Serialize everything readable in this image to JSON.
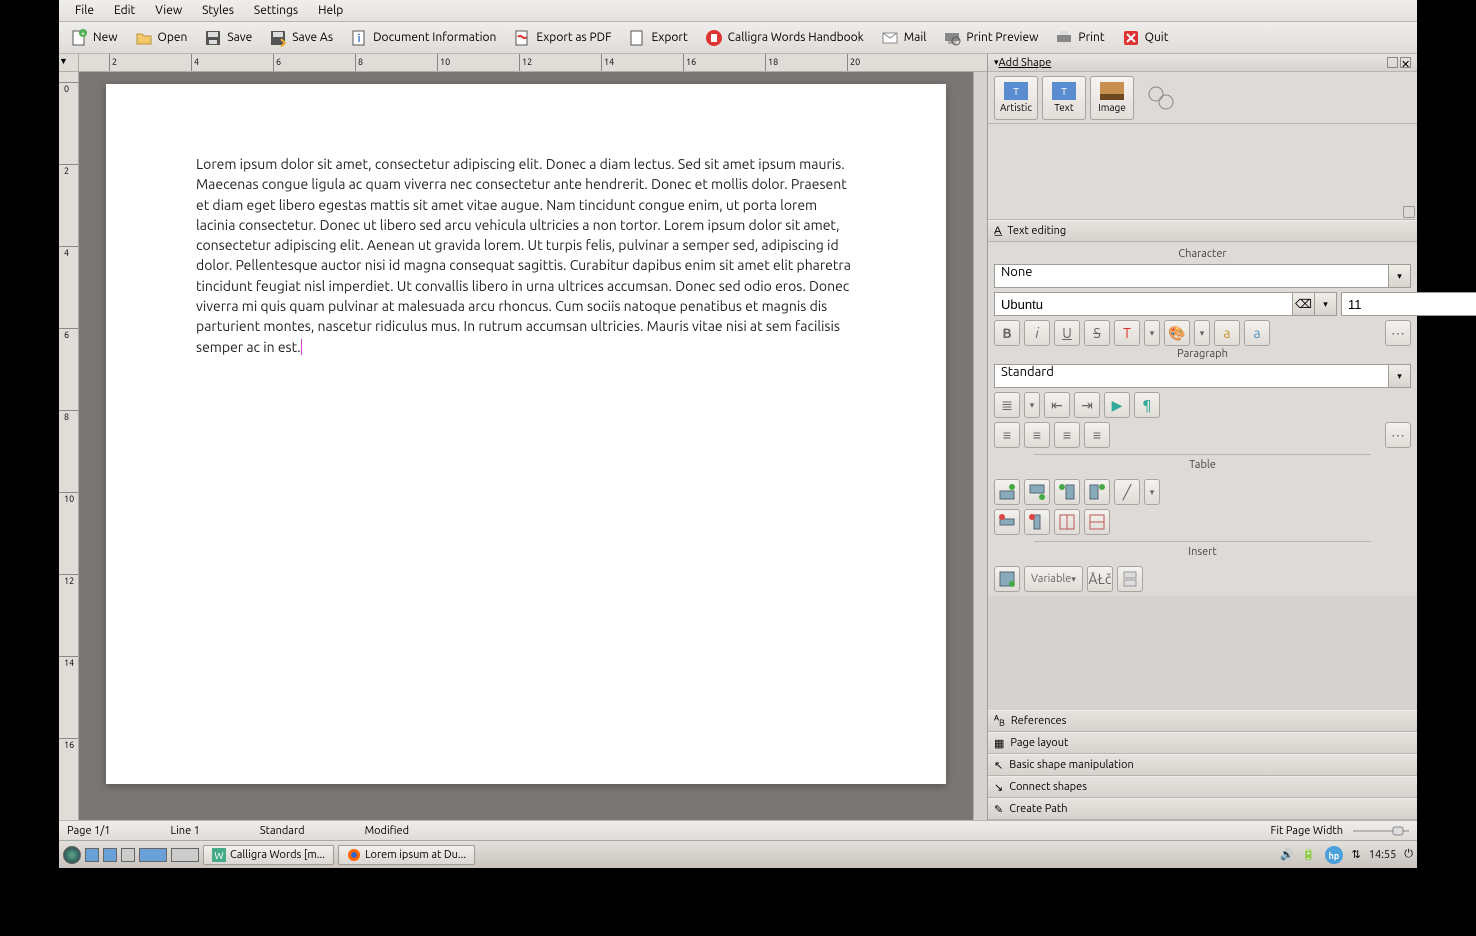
{
  "menu": {
    "file": "File",
    "edit": "Edit",
    "view": "View",
    "styles": "Styles",
    "settings": "Settings",
    "help": "Help"
  },
  "toolbar": {
    "new": "New",
    "open": "Open",
    "save": "Save",
    "saveas": "Save As",
    "docinfo": "Document Information",
    "exportpdf": "Export as PDF",
    "export": "Export",
    "handbook": "Calligra Words Handbook",
    "mail": "Mail",
    "preview": "Print Preview",
    "print": "Print",
    "quit": "Quit"
  },
  "ruler_h": [
    "2",
    "4",
    "6",
    "8",
    "10",
    "12",
    "14",
    "16",
    "18",
    "20"
  ],
  "ruler_v": [
    "0",
    "2",
    "4",
    "6",
    "8",
    "10",
    "12",
    "14",
    "16"
  ],
  "document": {
    "text": "Lorem ipsum dolor sit amet, consectetur adipiscing elit. Donec a diam lectus. Sed sit amet ipsum mauris. Maecenas congue ligula ac quam viverra nec consectetur ante hendrerit. Donec et mollis dolor. Praesent et diam eget libero egestas mattis sit amet vitae augue. Nam tincidunt congue enim, ut porta lorem lacinia consectetur. Donec ut libero sed arcu vehicula ultricies a non tortor. Lorem ipsum dolor sit amet, consectetur adipiscing elit. Aenean ut gravida lorem. Ut turpis felis, pulvinar a semper sed, adipiscing id dolor. Pellentesque auctor nisi id magna consequat sagittis. Curabitur dapibus enim sit amet elit pharetra tincidunt feugiat nisl imperdiet. Ut convallis libero in urna ultrices accumsan. Donec sed odio eros. Donec viverra mi quis quam pulvinar at malesuada arcu rhoncus. Cum sociis natoque penatibus et magnis dis parturient montes, nascetur ridiculus mus. In rutrum accumsan ultricies. Mauris vitae nisi at sem facilisis semper ac in est."
  },
  "side": {
    "addshape": "Add Shape",
    "shapes": {
      "artistic": "Artistic",
      "text": "Text",
      "image": "Image"
    },
    "textediting": "Text editing",
    "character": "Character",
    "char_style": "None",
    "font": "Ubuntu",
    "fontsize": "11",
    "paragraph": "Paragraph",
    "para_style": "Standard",
    "table": "Table",
    "insert": "Insert",
    "variable": "Variable",
    "references": "References",
    "pagelayout": "Page layout",
    "basicshape": "Basic shape manipulation",
    "connect": "Connect shapes",
    "createpath": "Create Path"
  },
  "status": {
    "page": "Page 1/1",
    "line": "Line 1",
    "style": "Standard",
    "modified": "Modified",
    "zoom": "Fit Page Width"
  },
  "taskbar": {
    "app1": "Calligra Words [m...",
    "app2": "Lorem ipsum at Du...",
    "time": "14:55"
  }
}
